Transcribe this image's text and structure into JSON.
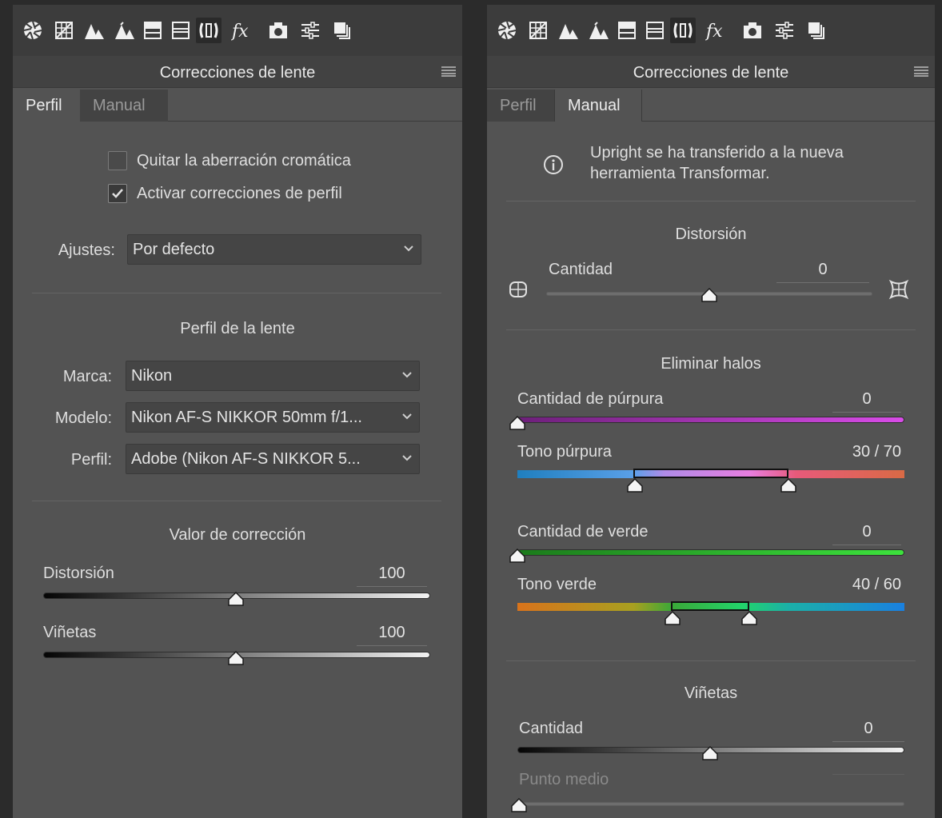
{
  "toolbar_icons": [
    "aperture-icon",
    "grid-icon",
    "mountain-icon",
    "split-tone-icon",
    "detail-icon",
    "lens-icon",
    "fx-icon",
    "camera-icon",
    "sliders-icon",
    "presets-icon"
  ],
  "left": {
    "title": "Correcciones de lente",
    "tabs": {
      "profile": "Perfil",
      "manual": "Manual"
    },
    "checkbox_ca": "Quitar la aberración cromática",
    "checkbox_profile": "Activar correcciones de perfil",
    "ajustes_label": "Ajustes:",
    "ajustes_value": "Por defecto",
    "lens_profile_title": "Perfil de la lente",
    "marca_label": "Marca:",
    "marca_value": "Nikon",
    "modelo_label": "Modelo:",
    "modelo_value": "Nikon AF-S NIKKOR 50mm f/1...",
    "perfil_label": "Perfil:",
    "perfil_value": "Adobe (Nikon AF-S NIKKOR 5...",
    "correction_title": "Valor de corrección",
    "distortion_label": "Distorsión",
    "distortion_value": "100",
    "vignette_label": "Viñetas",
    "vignette_value": "100",
    "checkbox_ca_checked": false,
    "checkbox_profile_checked": true,
    "distortion_level": 100,
    "vignette_level": 100
  },
  "right": {
    "title": "Correcciones de lente",
    "tabs": {
      "profile": "Perfil",
      "manual": "Manual"
    },
    "info_line1": "Upright se ha transferido a la nueva",
    "info_line2": "herramienta Transformar.",
    "distortion_title": "Distorsión",
    "amount_label": "Cantidad",
    "amount_value": "0",
    "defringe_title": "Eliminar halos",
    "purple_amount_label": "Cantidad de púrpura",
    "purple_amount_value": "0",
    "purple_hue_label": "Tono púrpura",
    "purple_hue_value": "30 / 70",
    "green_amount_label": "Cantidad de verde",
    "green_amount_value": "0",
    "green_hue_label": "Tono verde",
    "green_hue_value": "40 / 60",
    "vignette_title": "Viñetas",
    "vignette_amount_label": "Cantidad",
    "vignette_amount_value": "0",
    "midpoint_label": "Punto medio",
    "distortion_amount": 0,
    "purple_amount": 0,
    "purple_hue_range": [
      30,
      70
    ],
    "green_amount": 0,
    "green_hue_range": [
      40,
      60
    ],
    "vignette_amount": 0
  }
}
